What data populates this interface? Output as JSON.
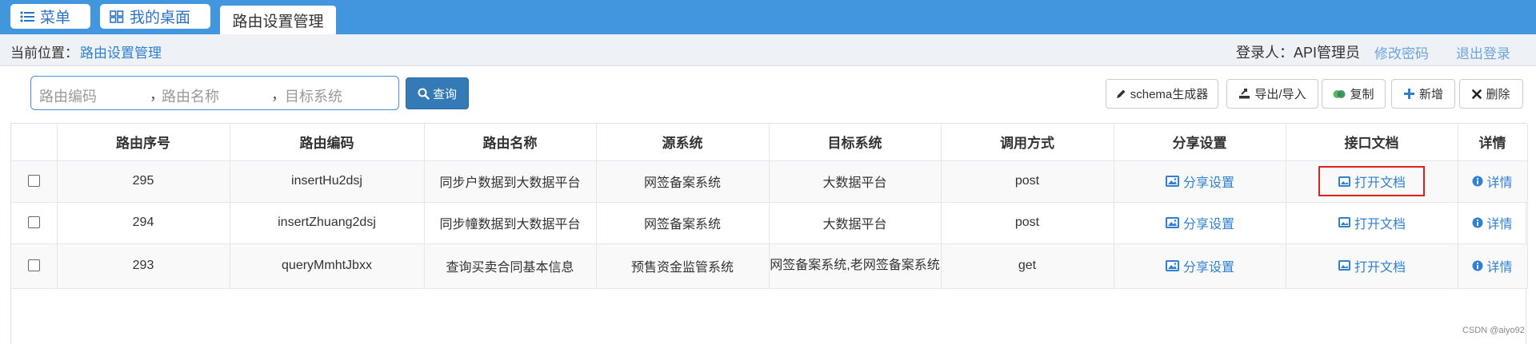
{
  "topbar": {
    "menu_label": "菜单",
    "desktop_label": "我的桌面",
    "active_tab": "路由设置管理"
  },
  "breadcrumb": {
    "label": "当前位置：",
    "current": "路由设置管理"
  },
  "user": {
    "login_text": "登录人：API管理员",
    "change_password": "修改密码",
    "logout": "退出登录"
  },
  "search": {
    "placeholder_code": "路由编码",
    "placeholder_name": "路由名称",
    "placeholder_target": "目标系统",
    "separator": "，",
    "query_label": "查询"
  },
  "toolbar": {
    "schema": "schema生成器",
    "export_import": "导出/导入",
    "copy": "复制",
    "add": "新增",
    "delete": "删除"
  },
  "table": {
    "headers": [
      "路由序号",
      "路由编码",
      "路由名称",
      "源系统",
      "目标系统",
      "调用方式",
      "分享设置",
      "接口文档",
      "详情"
    ],
    "rows": [
      {
        "seq": "295",
        "code": "insertHu2dsj",
        "name": "同步户数据到大数据平台",
        "source": "网签备案系统",
        "target": "大数据平台",
        "method": "post",
        "share": "分享设置",
        "doc": "打开文档",
        "detail": "详情"
      },
      {
        "seq": "294",
        "code": "insertZhuang2dsj",
        "name": "同步幢数据到大数据平台",
        "source": "网签备案系统",
        "target": "大数据平台",
        "method": "post",
        "share": "分享设置",
        "doc": "打开文档",
        "detail": "详情"
      },
      {
        "seq": "293",
        "code": "queryMmhtJbxx",
        "name": "查询买卖合同基本信息",
        "source": "预售资金监管系统",
        "target": "网签备案系统,老网签备案系统",
        "method": "get",
        "share": "分享设置",
        "doc": "打开文档",
        "detail": "详情"
      }
    ]
  },
  "watermark": "CSDN @aiyo92",
  "colors": {
    "topbar": "#4196de",
    "link": "#2f80d1",
    "primary_button": "#337ab7",
    "highlight": "#e0201e"
  },
  "icons": {
    "menu": "list-icon",
    "desktop": "grid-icon",
    "query": "search-icon",
    "schema": "pencil-icon",
    "export": "export-icon",
    "copy": "copy-icon",
    "add": "plus-icon",
    "delete": "x-icon",
    "share": "image-icon",
    "doc": "image-icon",
    "detail": "info-icon"
  }
}
